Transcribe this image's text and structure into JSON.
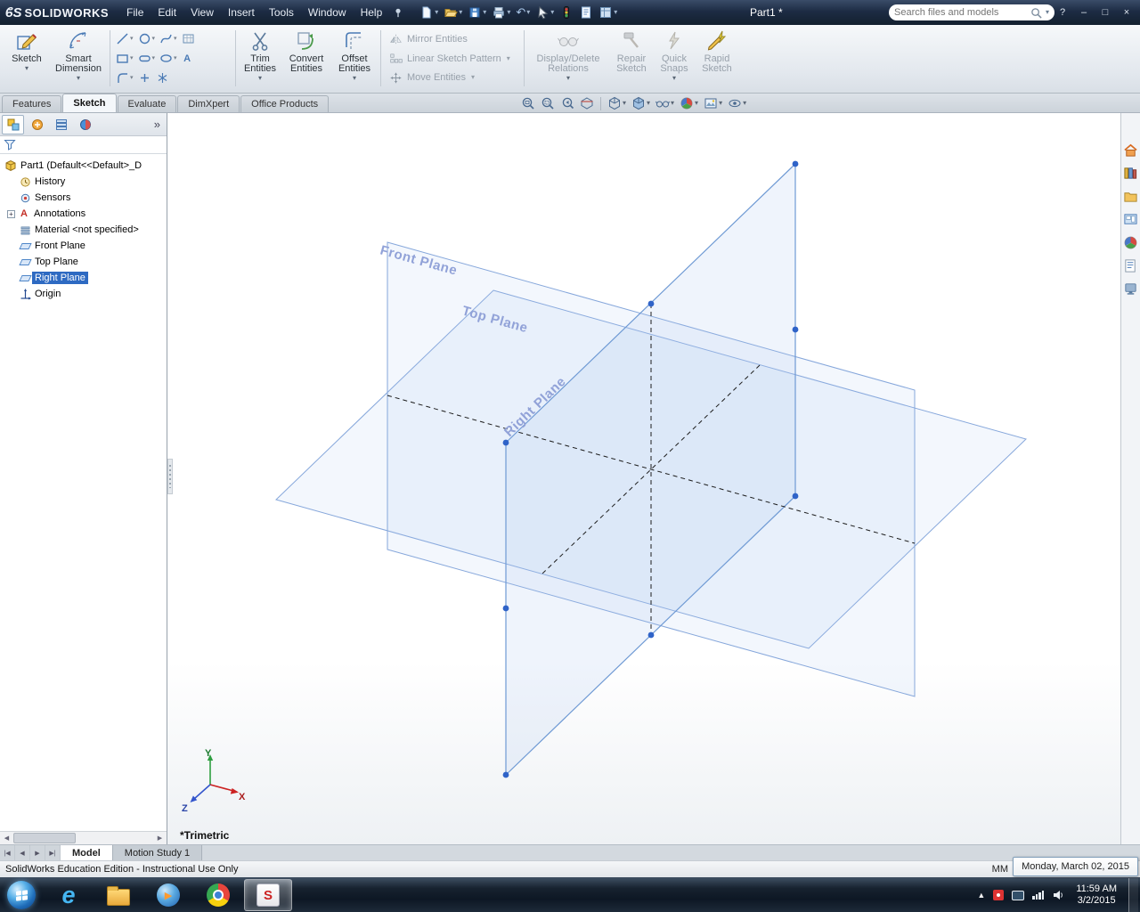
{
  "colors": {
    "titlebar_bg": "#1d2c44",
    "selection_blue": "#2e6ac2",
    "plane_stroke": "#86a7db",
    "plane_fill": "rgba(172,198,238,0.14)",
    "handle_blue": "#2f63c8",
    "plane_label_blue": "#91a2d8"
  },
  "icons": {
    "caret": "▾",
    "chevron_double": "»",
    "plus": "+",
    "undo": "↶",
    "help": "?",
    "minimize": "–",
    "restore": "□",
    "close": "×",
    "nav_first": "|◀",
    "nav_prev": "◀",
    "nav_next": "▶",
    "nav_last": "▶|",
    "scroll_left": "◀",
    "scroll_right": "▶",
    "tray_up": "▲",
    "annotation_a": "A",
    "ie_e": "e",
    "wmp_play": "▶",
    "sw_badge": "S"
  },
  "title_bar": {
    "logo_glyph": "ϐS",
    "logo_text": "SOLIDWORKS",
    "menus": [
      "File",
      "Edit",
      "View",
      "Insert",
      "Tools",
      "Window",
      "Help"
    ],
    "document_title": "Part1 *",
    "search_placeholder": "Search files and models"
  },
  "ribbon": {
    "sketch": "Sketch",
    "smart_dimension": "Smart Dimension",
    "trim": "Trim Entities",
    "convert": "Convert Entities",
    "offset": "Offset Entities",
    "mirror": "Mirror Entities",
    "linear_pattern": "Linear Sketch Pattern",
    "move": "Move Entities",
    "display_delete": "Display/Delete Relations",
    "repair": "Repair Sketch",
    "quick_snaps": "Quick Snaps",
    "rapid": "Rapid Sketch",
    "text_tool": "A"
  },
  "tabs": {
    "items": [
      "Features",
      "Sketch",
      "Evaluate",
      "DimXpert",
      "Office Products"
    ],
    "active": "Sketch"
  },
  "feature_tree": {
    "items": [
      {
        "label": "Part1  (Default<<Default>_D"
      },
      {
        "label": "History"
      },
      {
        "label": "Sensors"
      },
      {
        "label": "Annotations"
      },
      {
        "label": "Material <not specified>"
      },
      {
        "label": "Front Plane"
      },
      {
        "label": "Top Plane"
      },
      {
        "label": "Right Plane"
      },
      {
        "label": "Origin"
      }
    ],
    "selected": "Right Plane"
  },
  "viewport": {
    "front_plane_label": "Front Plane",
    "top_plane_label": "Top Plane",
    "right_plane_label": "Right Plane",
    "view_orientation_label": "*Trimetric",
    "triad": {
      "x": "X",
      "y": "Y",
      "z": "Z"
    }
  },
  "doc_tabs": {
    "model": "Model",
    "motion_study": "Motion Study 1"
  },
  "status_bar": {
    "message": "SolidWorks Education Edition - Instructional Use Only",
    "units": "MM"
  },
  "tooltip": {
    "text": "Monday, March 02, 2015"
  },
  "taskbar": {
    "time": "11:59 AM",
    "date": "3/2/2015"
  }
}
